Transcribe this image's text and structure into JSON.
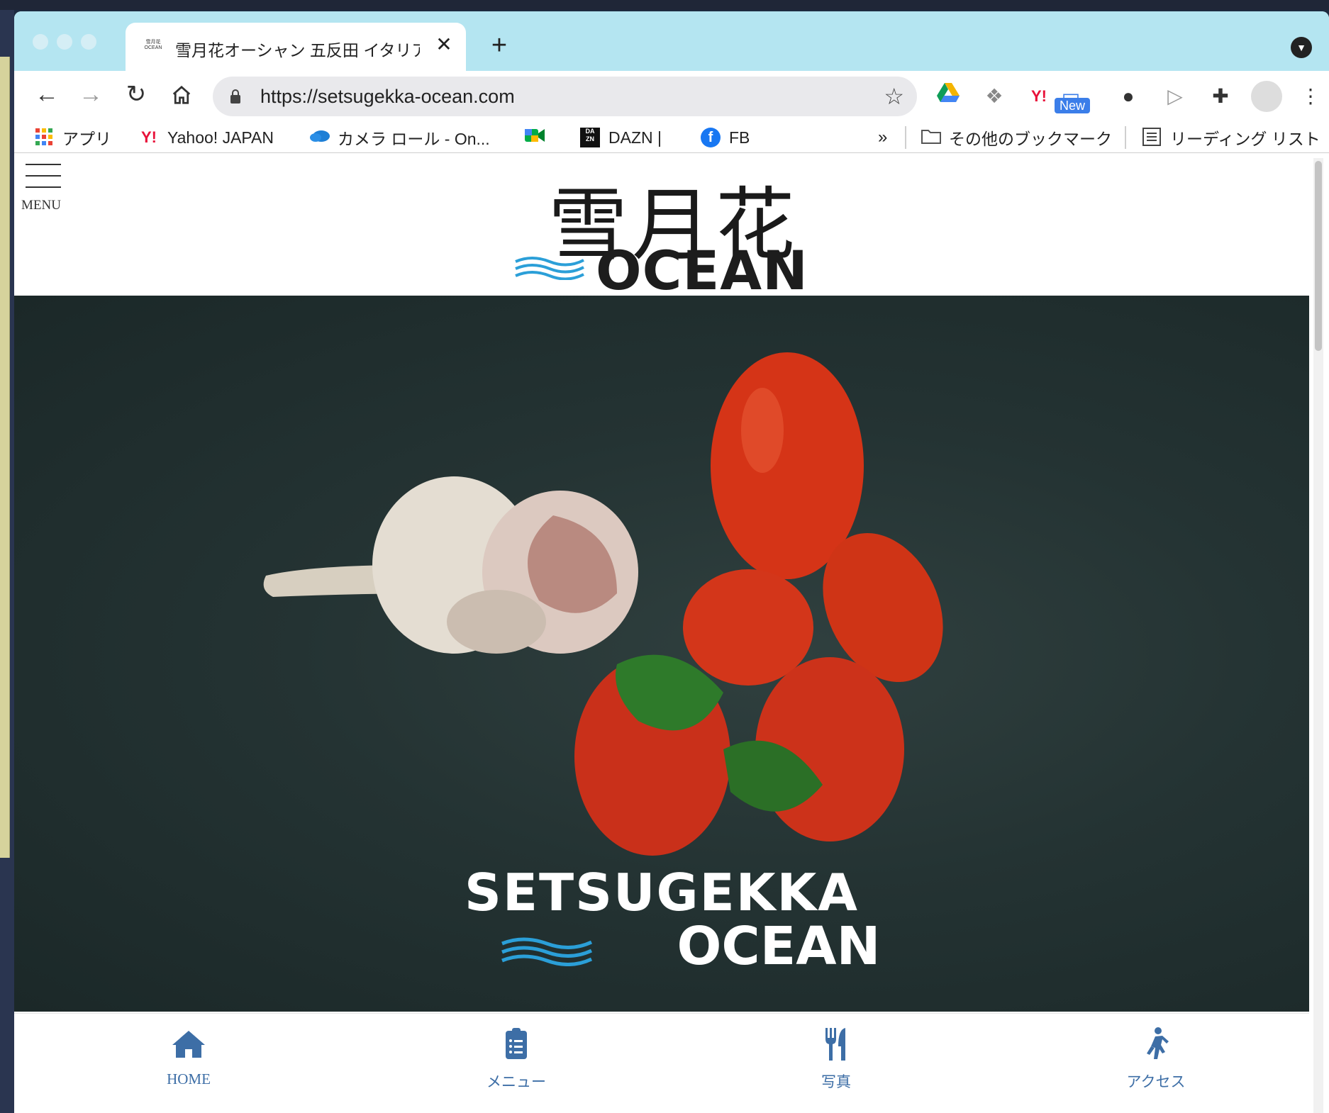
{
  "browser": {
    "tab_title": "雪月花オーシャン 五反田 イタリア",
    "tab_favicon_text": "雪月花 OCEAN",
    "url": "https://setsugekka-ocean.com",
    "new_badge": "New"
  },
  "bookmarks": [
    {
      "label": "アプリ",
      "icon": "apps-grid-icon"
    },
    {
      "label": "Yahoo! JAPAN",
      "icon": "yahoo-icon"
    },
    {
      "label": "カメラ ロール - On...",
      "icon": "onedrive-icon"
    },
    {
      "label": "",
      "icon": "google-meet-icon"
    },
    {
      "label": "DAZN |",
      "icon": "dazn-icon"
    },
    {
      "label": "FB",
      "icon": "facebook-icon"
    }
  ],
  "bookmarks_overflow": "»",
  "other_bookmarks": "その他のブックマーク",
  "reading_list": "リーディング リスト",
  "site": {
    "menu_label": "MENU",
    "logo_kanji": "雪月花",
    "logo_word": "OCEAN",
    "hero_line1": "SETSUGEKKA",
    "hero_line2": "OCEAN"
  },
  "bottom_nav": [
    {
      "label": "HOME",
      "icon": "home-icon"
    },
    {
      "label": "メニュー",
      "icon": "clipboard-list-icon"
    },
    {
      "label": "写真",
      "icon": "utensils-icon"
    },
    {
      "label": "アクセス",
      "icon": "walking-person-icon"
    }
  ],
  "colors": {
    "tabstrip": "#b4e5f1",
    "nav_accent": "#3d6ea6",
    "hero_bg": "#243333",
    "wave_blue": "#2b9fd8"
  }
}
